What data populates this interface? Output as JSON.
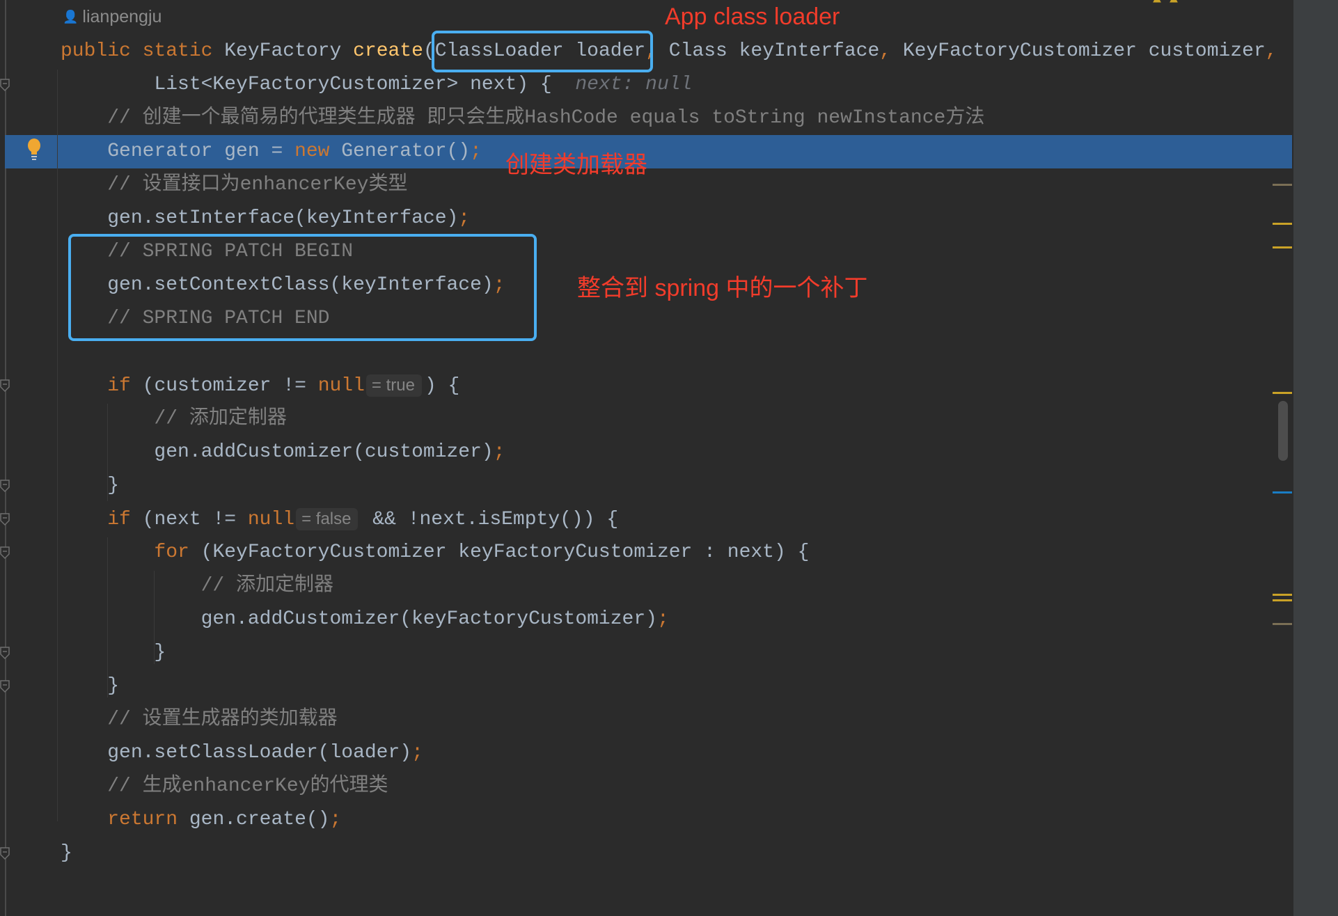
{
  "editor": {
    "author": "lianpengju",
    "lines": [
      [
        [
          "public static ",
          "kw"
        ],
        [
          "KeyFactory ",
          "pl"
        ],
        [
          "create",
          "fn"
        ],
        [
          "(ClassLoader loader",
          "pl"
        ],
        [
          ", ",
          "kw"
        ],
        [
          "Class keyInterface",
          "pl"
        ],
        [
          ", ",
          "kw"
        ],
        [
          "KeyFactoryCustomizer customizer",
          "pl"
        ],
        [
          ",",
          "kw"
        ]
      ],
      [
        [
          "        List<KeyFactoryCustomizer> next) {  ",
          "pl"
        ],
        [
          "next: null",
          "it"
        ]
      ],
      [
        [
          "    // 创建一个最简易的代理类生成器 即只会生成HashCode equals toString newInstance方法",
          "cm"
        ]
      ],
      [
        [
          "    Generator gen = ",
          "pl"
        ],
        [
          "new ",
          "kw"
        ],
        [
          "Generator()",
          "pl"
        ],
        [
          ";",
          "kw"
        ]
      ],
      [
        [
          "    // 设置接口为enhancerKey类型",
          "cm"
        ]
      ],
      [
        [
          "    gen.setInterface(keyInterface)",
          "pl"
        ],
        [
          ";",
          "kw"
        ]
      ],
      [
        [
          "    // SPRING PATCH BEGIN",
          "cm"
        ]
      ],
      [
        [
          "    gen.setContextClass(keyInterface)",
          "pl"
        ],
        [
          ";",
          "kw"
        ]
      ],
      [
        [
          "    // SPRING PATCH END",
          "cm"
        ]
      ],
      [],
      [
        [
          "    ",
          "pl"
        ],
        [
          "if ",
          "kw"
        ],
        [
          "(customizer != ",
          "pl"
        ],
        [
          "null",
          "kw"
        ],
        [
          "= true",
          "hint"
        ],
        [
          ") {",
          "pl"
        ]
      ],
      [
        [
          "        // 添加定制器",
          "cm"
        ]
      ],
      [
        [
          "        gen.addCustomizer(customizer)",
          "pl"
        ],
        [
          ";",
          "kw"
        ]
      ],
      [
        [
          "    }",
          "pl"
        ]
      ],
      [
        [
          "    ",
          "pl"
        ],
        [
          "if ",
          "kw"
        ],
        [
          "(next != ",
          "pl"
        ],
        [
          "null",
          "kw"
        ],
        [
          "= false",
          "hint"
        ],
        [
          " && !next.isEmpty()) {",
          "pl"
        ]
      ],
      [
        [
          "        ",
          "pl"
        ],
        [
          "for ",
          "kw"
        ],
        [
          "(KeyFactoryCustomizer keyFactoryCustomizer : next) {",
          "pl"
        ]
      ],
      [
        [
          "            // 添加定制器",
          "cm"
        ]
      ],
      [
        [
          "            gen.addCustomizer(keyFactoryCustomizer)",
          "pl"
        ],
        [
          ";",
          "kw"
        ]
      ],
      [
        [
          "        }",
          "pl"
        ]
      ],
      [
        [
          "    }",
          "pl"
        ]
      ],
      [
        [
          "    // 设置生成器的类加载器",
          "cm"
        ]
      ],
      [
        [
          "    gen.setClassLoader(loader)",
          "pl"
        ],
        [
          ";",
          "kw"
        ]
      ],
      [
        [
          "    // 生成enhancerKey的代理类",
          "cm"
        ]
      ],
      [
        [
          "    ",
          "pl"
        ],
        [
          "return ",
          "kw"
        ],
        [
          "gen.create()",
          "pl"
        ],
        [
          ";",
          "kw"
        ]
      ],
      [
        [
          "}",
          "pl"
        ]
      ]
    ]
  },
  "annotations": {
    "app_class_loader": "App class loader",
    "create_loader": "创建类加载器",
    "spring_patch": "整合到 spring 中的一个补丁"
  },
  "colors": {
    "keyword": "#cc7832",
    "comment": "#808080",
    "highlight": "#2d5e96",
    "annotation": "#f23c2b",
    "box": "#4aaef0"
  },
  "icons": {
    "author": "person-icon",
    "intention": "lightbulb-icon"
  }
}
